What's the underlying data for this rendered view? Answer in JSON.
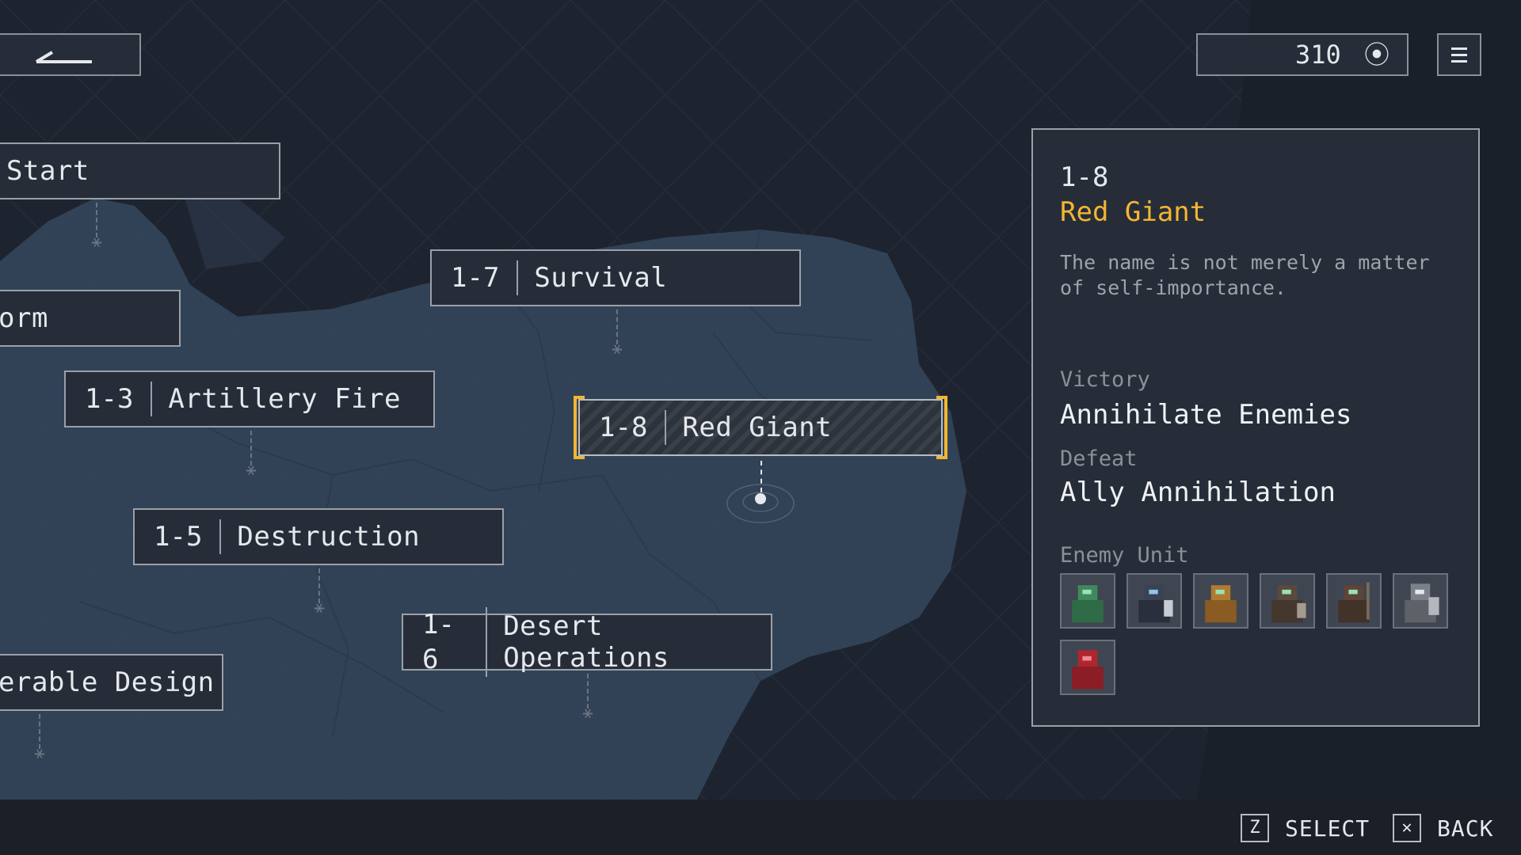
{
  "top": {
    "coins": "310",
    "coin_icon": "coin-icon",
    "menu_icon": "hamburger-menu-icon",
    "back_icon": "back-arrow-icon"
  },
  "stages": [
    {
      "id": "start",
      "number": "",
      "name": "Start"
    },
    {
      "id": "orm",
      "number": "",
      "name": "orm"
    },
    {
      "id": "1-3",
      "number": "1-3",
      "name": "Artillery Fire"
    },
    {
      "id": "1-5",
      "number": "1-5",
      "name": "Destruction"
    },
    {
      "id": "design",
      "number": "",
      "name": "erable Design"
    },
    {
      "id": "1-7",
      "number": "1-7",
      "name": "Survival"
    },
    {
      "id": "1-8",
      "number": "1-8",
      "name": "Red Giant"
    },
    {
      "id": "1-6",
      "number": "1-6",
      "name": "Desert Operations"
    }
  ],
  "panel": {
    "number": "1-8",
    "title": "Red Giant",
    "description": "The name is not merely a matter of self-importance.",
    "victory_label": "Victory",
    "victory_value": "Annihilate Enemies",
    "defeat_label": "Defeat",
    "defeat_value": "Ally Annihilation",
    "enemy_label": "Enemy Unit",
    "enemy_units": [
      {
        "name": "green-mech-icon",
        "color": "#3f8a5c"
      },
      {
        "name": "dark-mech-icon",
        "color": "#3b4256"
      },
      {
        "name": "tan-mech-icon",
        "color": "#b07a30"
      },
      {
        "name": "brown-mech-icon",
        "color": "#5a4a3e"
      },
      {
        "name": "brown-mech-icon",
        "color": "#5c4536"
      },
      {
        "name": "grey-mech-icon",
        "color": "#7c8088"
      },
      {
        "name": "red-mech-icon",
        "color": "#b0262f"
      }
    ]
  },
  "controls": [
    {
      "key": "Z",
      "label": "SELECT"
    },
    {
      "key": "✕",
      "label": "BACK"
    }
  ],
  "colors": {
    "accent": "#f2b632",
    "background": "#1c222d",
    "panel": "#262d39",
    "land": "#33445a"
  }
}
